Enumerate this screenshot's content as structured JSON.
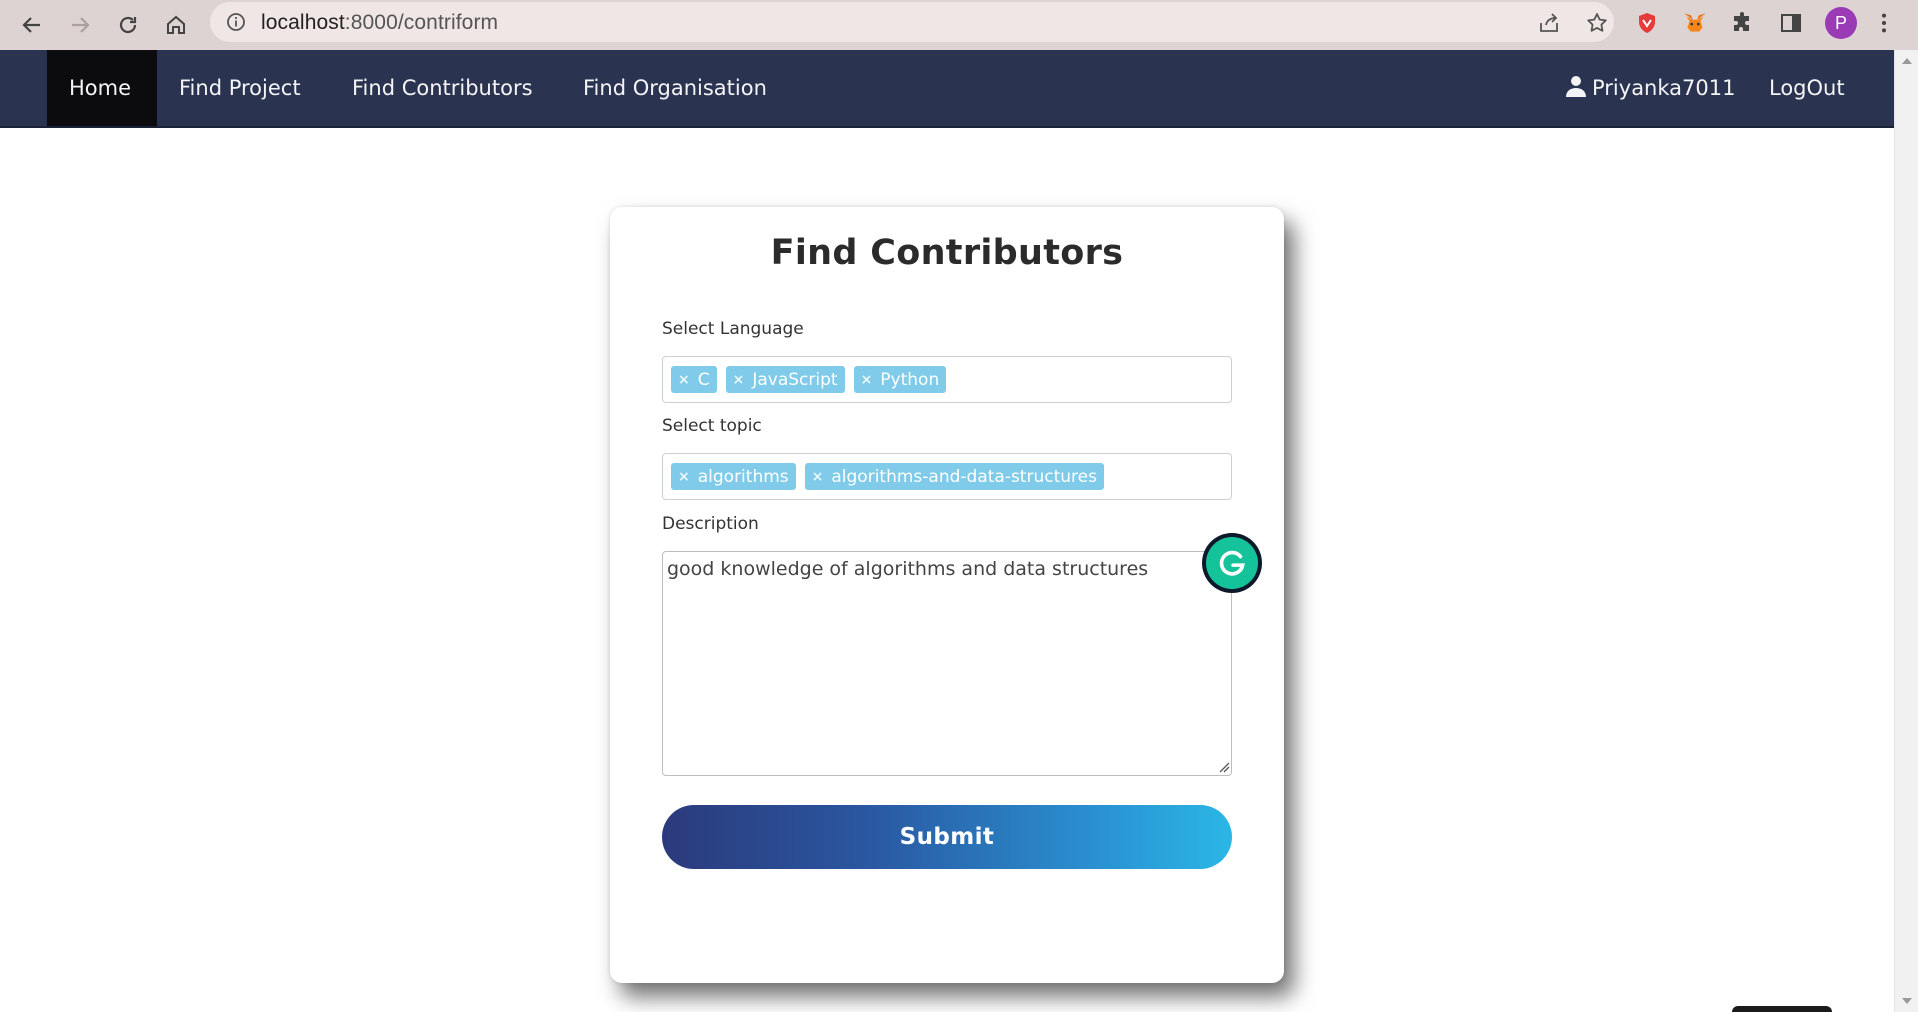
{
  "browser": {
    "url_host": "localhost",
    "url_path": ":8000/contriform",
    "profile_initial": "P",
    "icons": [
      "back-icon",
      "forward-icon",
      "reload-icon",
      "home-icon",
      "site-info-icon",
      "share-icon",
      "bookmark-star-icon",
      "extension-shield-icon",
      "metamask-fox-icon",
      "extensions-puzzle-icon",
      "side-panel-icon",
      "menu-dots-icon"
    ]
  },
  "navbar": {
    "items": [
      {
        "label": "Home",
        "active": true
      },
      {
        "label": "Find Project",
        "active": false
      },
      {
        "label": "Find Contributors",
        "active": false
      },
      {
        "label": "Find Organisation",
        "active": false
      }
    ],
    "user": "Priyanka7011",
    "logout": "LogOut",
    "colors": {
      "background": "#2a3350",
      "active": "#0c0c0e"
    }
  },
  "form": {
    "title": "Find Contributors",
    "language_label": "Select Language",
    "languages": [
      "C",
      "JavaScript",
      "Python"
    ],
    "topic_label": "Select topic",
    "topics": [
      "algorithms",
      "algorithms-and-data-structures"
    ],
    "description_label": "Description",
    "description_value": "good knowledge of algorithms and data structures",
    "submit_label": "Submit",
    "colors": {
      "tag": "#7fcbe9",
      "submit_start": "#2b3a7b",
      "submit_end": "#2bb6e6"
    }
  }
}
